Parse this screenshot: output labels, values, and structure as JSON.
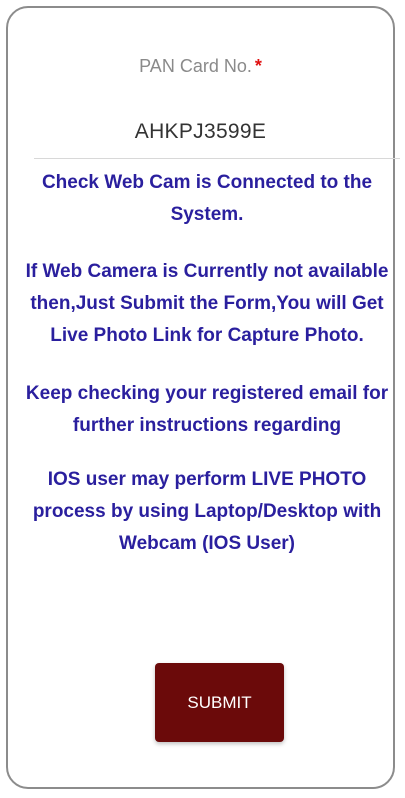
{
  "form": {
    "pan_label": "PAN Card No.",
    "required_marker": "*",
    "pan_value": "AHKPJ3599E",
    "messages": [
      "Check Web Cam is Connected to the System.",
      "If Web Camera is Currently not available then,Just Submit the Form,You will Get Live Photo Link for Capture Photo.",
      "Keep checking your registered email for further instructions regarding",
      "IOS user may perform LIVE PHOTO process by using Laptop/Desktop with Webcam (IOS User)"
    ],
    "submit_label": "SUBMIT"
  },
  "colors": {
    "message_text": "#2a1f9e",
    "submit_background": "#6b0a0a",
    "required_marker": "#e01010"
  }
}
